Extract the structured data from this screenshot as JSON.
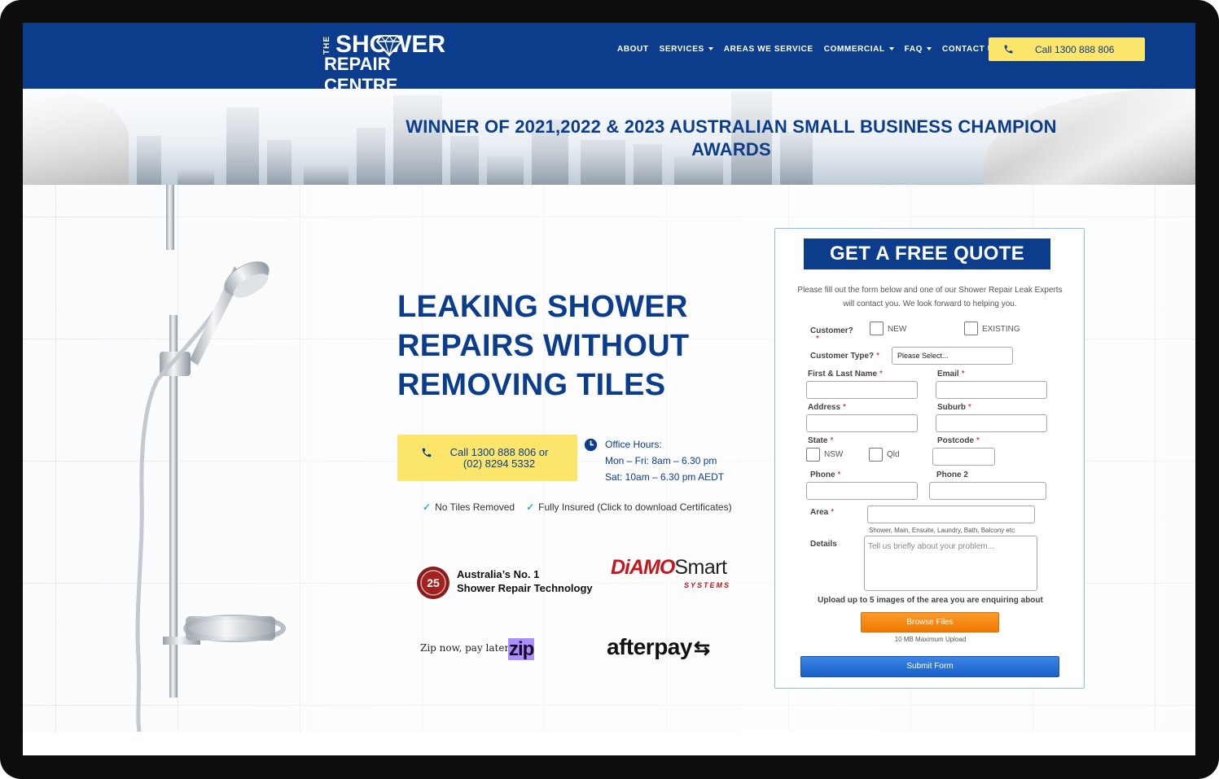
{
  "header": {
    "logo": {
      "line_the": "THE",
      "line1": "SHOWER",
      "line2": "REPAIR CENTRE"
    },
    "nav": [
      {
        "label": "ABOUT",
        "dropdown": false
      },
      {
        "label": "SERVICES",
        "dropdown": true
      },
      {
        "label": "AREAS WE SERVICE",
        "dropdown": false
      },
      {
        "label": "COMMERCIAL",
        "dropdown": true
      },
      {
        "label": "FAQ",
        "dropdown": true
      },
      {
        "label": "CONTACT US",
        "dropdown": false
      }
    ],
    "call_label": "Call 1300 888 806"
  },
  "banner": {
    "title": "WINNER OF 2021,2022 & 2023 AUSTRALIAN SMALL BUSINESS CHAMPION AWARDS"
  },
  "hero": {
    "headline": "LEAKING SHOWER REPAIRS WITHOUT REMOVING TILES",
    "call_line1": "Call 1300 888 806 or",
    "call_line2": "(02) 8294 5332",
    "hours": {
      "label": "Office Hours:",
      "weekday": "Mon – Fri: 8am – 6.30 pm",
      "saturday": "Sat: 10am – 6.30 pm AEDT"
    },
    "checks": [
      "No Tiles Removed",
      "Fully Insured (Click to download Certificates)"
    ],
    "badge_number": "25",
    "badge_line1": "Australia’s No. 1",
    "badge_line2": "Shower Repair Technology",
    "diamo": {
      "part1": "DiAMO",
      "part2": "Smart",
      "systems": "SYSTEMS"
    },
    "zip_tagline": "Zip now, pay later",
    "zip_logo": "zip",
    "afterpay": "afterpay"
  },
  "form": {
    "title": "GET A FREE QUOTE",
    "intro": "Please fill out the form below and one of our Shower Repair Leak Experts will contact you. We look forward to helping you.",
    "customer_label": "Customer?",
    "customer_new": "NEW",
    "customer_existing": "EXISTING",
    "customer_type_label": "Customer Type?",
    "customer_type_value": "Please Select...",
    "name_label": "First & Last Name",
    "email_label": "Email",
    "address_label": "Address",
    "suburb_label": "Suburb",
    "state_label": "State",
    "state_nsw": "NSW",
    "state_qld": "Qld",
    "postcode_label": "Postcode",
    "phone_label": "Phone",
    "phone2_label": "Phone 2",
    "area_label": "Area",
    "area_hint": "Shower, Main, Ensuite, Laundry, Bath, Balcony etc",
    "details_label": "Details",
    "details_placeholder": "Tell us briefly about your problem...",
    "upload_label": "Upload up to 5 images of the area you are enquiring about",
    "browse_label": "Browse Files",
    "max_upload": "10 MB Maximum Upload",
    "submit_label": "Submit Form",
    "required_mark": "*"
  },
  "colors": {
    "brand_blue": "#0b3d8c",
    "accent_yellow": "#fbe56a",
    "check_teal": "#27b7a6",
    "browse_orange": "#f07a00",
    "submit_blue": "#1a5fc9"
  }
}
